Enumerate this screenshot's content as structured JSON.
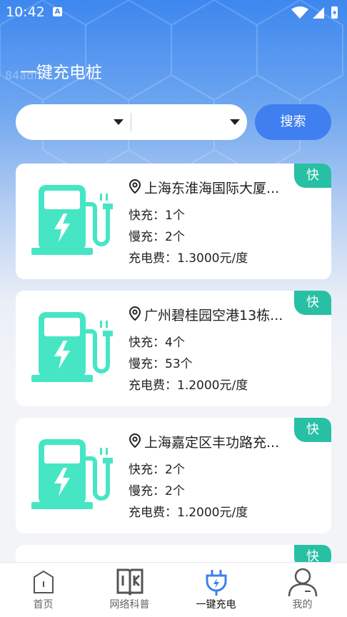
{
  "status_bar": {
    "time": "10:42",
    "app_badge": "A"
  },
  "header": {
    "ghost_text": "84adf",
    "title": "一键充电桩"
  },
  "search": {
    "button_label": "搜索"
  },
  "stations": [
    {
      "name": "上海东淮海国际大厦...",
      "fast": "快充：1个",
      "slow": "慢充：2个",
      "fee": "充电费：1.3000元/度",
      "tag": "快"
    },
    {
      "name": "广州碧桂园空港13栋...",
      "fast": "快充：4个",
      "slow": "慢充：53个",
      "fee": "充电费：1.2000元/度",
      "tag": "快"
    },
    {
      "name": "上海嘉定区丰功路充...",
      "fast": "快充：2个",
      "slow": "慢充：2个",
      "fee": "充电费：1.2000元/度",
      "tag": "快"
    },
    {
      "name": "",
      "fast": "",
      "slow": "",
      "fee": "",
      "tag": "快"
    }
  ],
  "tabbar": {
    "tabs": [
      {
        "label": "首页",
        "icon": "home-icon"
      },
      {
        "label": "网络科普",
        "icon": "book-icon"
      },
      {
        "label": "一键充电",
        "icon": "plug-icon"
      },
      {
        "label": "我的",
        "icon": "user-icon"
      }
    ],
    "active_index": 2
  },
  "colors": {
    "accent": "#3f7ff0",
    "tag": "#27c0a4",
    "charger": "#46e6c4"
  }
}
